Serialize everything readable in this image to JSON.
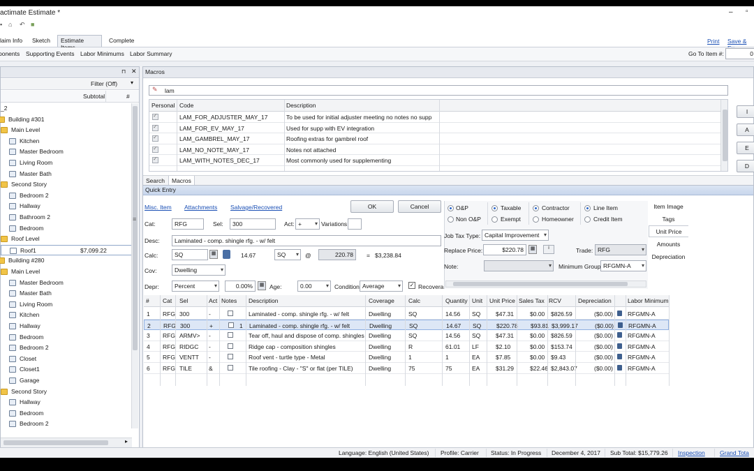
{
  "window": {
    "title": "actimate Estimate *"
  },
  "tabs": [
    "laim Info",
    "Sketch",
    "Estimate Items",
    "Complete"
  ],
  "top_links": {
    "print": "Print",
    "save": "Save & Ex"
  },
  "subbar": {
    "items": [
      "ponents",
      "Supporting Events",
      "Labor Minimums",
      "Labor Summary"
    ],
    "goto_label": "Go To Item #:",
    "goto_value": "0"
  },
  "left_panel": {
    "filter": "Filter (Off)",
    "subtotal_header": "Subtotal",
    "hash_header": "#",
    "tree": [
      {
        "label": "_2",
        "indent": 0,
        "icon": "none"
      },
      {
        "label": "Building #301",
        "indent": 0,
        "icon": "folder"
      },
      {
        "label": "Main Level",
        "indent": 1,
        "icon": "folder"
      },
      {
        "label": "Kitchen",
        "indent": 2,
        "icon": "room"
      },
      {
        "label": "Master Bedroom",
        "indent": 2,
        "icon": "room"
      },
      {
        "label": "Living Room",
        "indent": 2,
        "icon": "room"
      },
      {
        "label": "Master Bath",
        "indent": 2,
        "icon": "room"
      },
      {
        "label": "Second Story",
        "indent": 1,
        "icon": "folder"
      },
      {
        "label": "Bedroom 2",
        "indent": 2,
        "icon": "room"
      },
      {
        "label": "Hallway",
        "indent": 2,
        "icon": "room"
      },
      {
        "label": "Bathroom 2",
        "indent": 2,
        "icon": "room"
      },
      {
        "label": "Bedroom",
        "indent": 2,
        "icon": "room"
      },
      {
        "label": "Roof Level",
        "indent": 1,
        "icon": "folder"
      },
      {
        "label": "Roof1",
        "indent": 2,
        "icon": "roomsel",
        "value": "$7,099.22"
      },
      {
        "label": "Building #280",
        "indent": 0,
        "icon": "folder"
      },
      {
        "label": "Main Level",
        "indent": 1,
        "icon": "folder"
      },
      {
        "label": "Master Bedroom",
        "indent": 2,
        "icon": "room"
      },
      {
        "label": "Master Bath",
        "indent": 2,
        "icon": "room"
      },
      {
        "label": "Living Room",
        "indent": 2,
        "icon": "room"
      },
      {
        "label": "Kitchen",
        "indent": 2,
        "icon": "room"
      },
      {
        "label": "Hallway",
        "indent": 2,
        "icon": "room"
      },
      {
        "label": "Bedroom",
        "indent": 2,
        "icon": "room"
      },
      {
        "label": "Bedroom 2",
        "indent": 2,
        "icon": "room"
      },
      {
        "label": "Closet",
        "indent": 2,
        "icon": "room"
      },
      {
        "label": "Closet1",
        "indent": 2,
        "icon": "room"
      },
      {
        "label": "Garage",
        "indent": 2,
        "icon": "room"
      },
      {
        "label": "Second Story",
        "indent": 1,
        "icon": "folder"
      },
      {
        "label": "Hallway",
        "indent": 2,
        "icon": "room"
      },
      {
        "label": "Bedroom",
        "indent": 2,
        "icon": "room"
      },
      {
        "label": "Bedroom 2",
        "indent": 2,
        "icon": "room"
      }
    ]
  },
  "macros": {
    "title": "Macros",
    "search_value": "lam",
    "headers": [
      "Personal",
      "Code",
      "Description"
    ],
    "rows": [
      {
        "code": "LAM_FOR_ADJUSTER_MAY_17",
        "desc": "To be used for initial adjuster meeting no notes no supp"
      },
      {
        "code": "LAM_FOR_EV_MAY_17",
        "desc": "Used for supp with EV integration"
      },
      {
        "code": "LAM_GAMBREL_MAY_17",
        "desc": "Roofing extras for gambrel roof"
      },
      {
        "code": "LAM_NO_NOTE_MAY_17",
        "desc": "Notes not attached"
      },
      {
        "code": "LAM_WITH_NOTES_DEC_17",
        "desc": "Most commonly used for supplementing"
      }
    ],
    "bottom_tabs": [
      "Search",
      "Macros"
    ],
    "side_buttons": [
      "I",
      "A",
      "E",
      "D"
    ]
  },
  "quick_entry": {
    "title": "Quick Entry",
    "links": [
      "Misc. Item",
      "Attachments",
      "Salvage/Recovered"
    ],
    "ok": "OK",
    "cancel": "Cancel",
    "cat_label": "Cat:",
    "cat_value": "RFG",
    "sel_label": "Sel:",
    "sel_value": "300",
    "act_label": "Act:",
    "act_value": "+",
    "variations_label": "Variations",
    "desc_label": "Desc:",
    "desc_value": "Laminated - comp. shingle rfg. - w/ felt",
    "calc_label": "Calc:",
    "calc_value": "SQ",
    "calc_qty": "14.67",
    "calc_unit": "SQ",
    "at": "@",
    "calc_price": "220.78",
    "eq": "=",
    "calc_total": "$3,238.84",
    "cov_label": "Cov:",
    "cov_value": "Dwelling",
    "depr_label": "Depr:",
    "depr_value": "Percent",
    "depr_pct": "0.00%",
    "age_label": "Age:",
    "age_value": "0.00",
    "condition_label": "Condition",
    "condition_value": "Average",
    "recoverable": "Recovera",
    "radios": {
      "op": "O&P",
      "non_op": "Non O&P",
      "taxable": "Taxable",
      "exempt": "Exempt",
      "contractor": "Contractor",
      "homeowner": "Homeowner",
      "line_item": "Line Item",
      "credit_item": "Credit Item"
    },
    "job_tax_label": "Job Tax Type:",
    "job_tax_value": "Capital Improvement",
    "replace_label": "Replace Price:",
    "replace_value": "$220.78",
    "trade_label": "Trade:",
    "trade_value": "RFG",
    "note_label": "Note:",
    "min_group_label": "Minimum Group:",
    "min_group_value": "RFGMN-A",
    "right_tabs": [
      "Item Image",
      "Tags",
      "Unit Price",
      "Amounts",
      "Depreciation"
    ]
  },
  "line_items": {
    "headers": [
      "#",
      "Cat",
      "Sel",
      "Act",
      "Notes",
      "Description",
      "Coverage",
      "Calc",
      "Quantity",
      "Unit",
      "Unit Price",
      "Sales Tax",
      "RCV",
      "Depreciation",
      "",
      "Labor Minimum"
    ],
    "rows": [
      {
        "n": "1",
        "cat": "RFG",
        "sel": "300",
        "act": "-",
        "note": "",
        "desc": "Laminated - comp. shingle rfg. - w/ felt",
        "cov": "Dwelling",
        "calc": "SQ",
        "qty": "14.56",
        "unit": "SQ",
        "price": "$47.31",
        "tax": "$0.00",
        "rcv": "$826.59",
        "dep": "($0.00)",
        "lab": "RFGMN-A"
      },
      {
        "n": "2",
        "cat": "RFG",
        "sel": "300",
        "act": "+",
        "note": "1",
        "desc": "Laminated - comp. shingle rfg. - w/ felt",
        "cov": "Dwelling",
        "calc": "SQ",
        "qty": "14.67",
        "unit": "SQ",
        "price": "$220.78",
        "tax": "$93.81",
        "rcv": "$3,999.17",
        "dep": "($0.00)",
        "lab": "RFGMN-A"
      },
      {
        "n": "3",
        "cat": "RFG",
        "sel": "ARMV>",
        "act": "-",
        "note": "",
        "desc": "Tear off, haul and dispose of comp. shingles",
        "cov": "Dwelling",
        "calc": "SQ",
        "qty": "14.56",
        "unit": "SQ",
        "price": "$47.31",
        "tax": "$0.00",
        "rcv": "$826.59",
        "dep": "($0.00)",
        "lab": "RFGMN-A"
      },
      {
        "n": "4",
        "cat": "RFG",
        "sel": "RIDGC",
        "act": "-",
        "note": "",
        "desc": "Ridge cap - composition shingles",
        "cov": "Dwelling",
        "calc": "R",
        "qty": "61.01",
        "unit": "LF",
        "price": "$2.10",
        "tax": "$0.00",
        "rcv": "$153.74",
        "dep": "($0.00)",
        "lab": "RFGMN-A"
      },
      {
        "n": "5",
        "cat": "RFG",
        "sel": "VENTT",
        "act": "-",
        "note": "",
        "desc": "Roof vent - turtle type - Metal",
        "cov": "Dwelling",
        "calc": "1",
        "qty": "1",
        "unit": "EA",
        "price": "$7.85",
        "tax": "$0.00",
        "rcv": "$9.43",
        "dep": "($0.00)",
        "lab": "RFGMN-A"
      },
      {
        "n": "6",
        "cat": "RFG",
        "sel": "TILE",
        "act": "&",
        "note": "",
        "desc": "Tile roofing - Clay - \"S\" or flat (per TILE)",
        "cov": "Dwelling",
        "calc": "75",
        "qty": "75",
        "unit": "EA",
        "price": "$31.29",
        "tax": "$22.46",
        "rcv": "$2,843.07",
        "dep": "($0.00)",
        "lab": "RFGMN-A"
      }
    ]
  },
  "status_bar": {
    "language": "Language:  English (United States)",
    "profile": "Profile:  Carrier",
    "status": "Status:  In Progress",
    "date": "December 4, 2017",
    "subtotal": "Sub Total: $15,779.26",
    "inspection": "Inspection",
    "grand_total": "Grand Tota"
  },
  "colors": {
    "accent": "#1a4fb5",
    "selection": "#dde7f6",
    "folder": "#f1c447"
  }
}
